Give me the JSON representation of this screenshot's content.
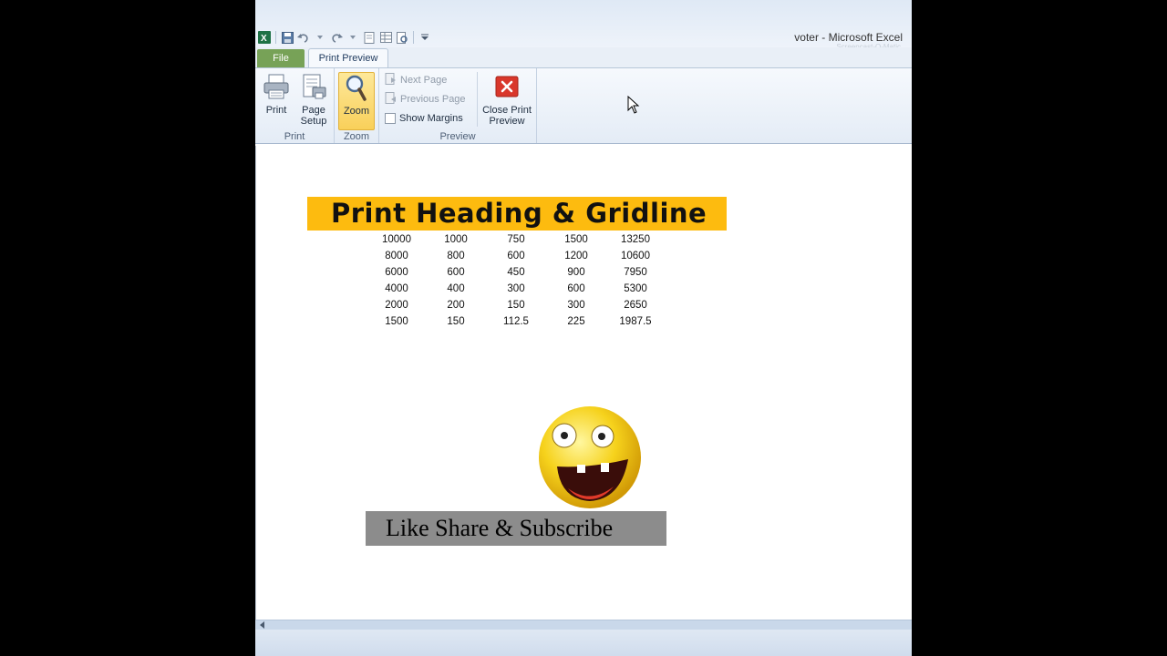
{
  "window": {
    "title": "voter  -  Microsoft Excel",
    "watermark": "Screencast-O-Matic"
  },
  "tabs": {
    "file": "File",
    "print_preview": "Print Preview"
  },
  "ribbon": {
    "print_group": {
      "label": "Print",
      "print_button": "Print",
      "page_setup_button": "Page Setup"
    },
    "zoom_group": {
      "label": "Zoom",
      "zoom_button": "Zoom"
    },
    "preview_group": {
      "label": "Preview",
      "next_page": "Next Page",
      "previous_page": "Previous Page",
      "show_margins": "Show Margins",
      "close_print_preview": "Close Print Preview"
    }
  },
  "page": {
    "heading": "Print Heading & Gridline",
    "rows": [
      [
        "10000",
        "1000",
        "750",
        "1500",
        "13250"
      ],
      [
        "8000",
        "800",
        "600",
        "1200",
        "10600"
      ],
      [
        "6000",
        "600",
        "450",
        "900",
        "7950"
      ],
      [
        "4000",
        "400",
        "300",
        "600",
        "5300"
      ],
      [
        "2000",
        "200",
        "150",
        "300",
        "2650"
      ],
      [
        "1500",
        "150",
        "112.5",
        "225",
        "1987.5"
      ]
    ],
    "subscribe_text": "Like Share & Subscribe"
  },
  "colors": {
    "heading_bg": "#fdbb0f",
    "file_tab": "#77a257",
    "zoom_active": "#f9d05a",
    "banner_bg": "#8c8c8c"
  },
  "icons": [
    "excel-icon",
    "save-icon",
    "undo-icon",
    "redo-icon",
    "printer-icon",
    "page-setup-icon",
    "magnifier-icon",
    "close-preview-icon",
    "smiley-emoji"
  ]
}
